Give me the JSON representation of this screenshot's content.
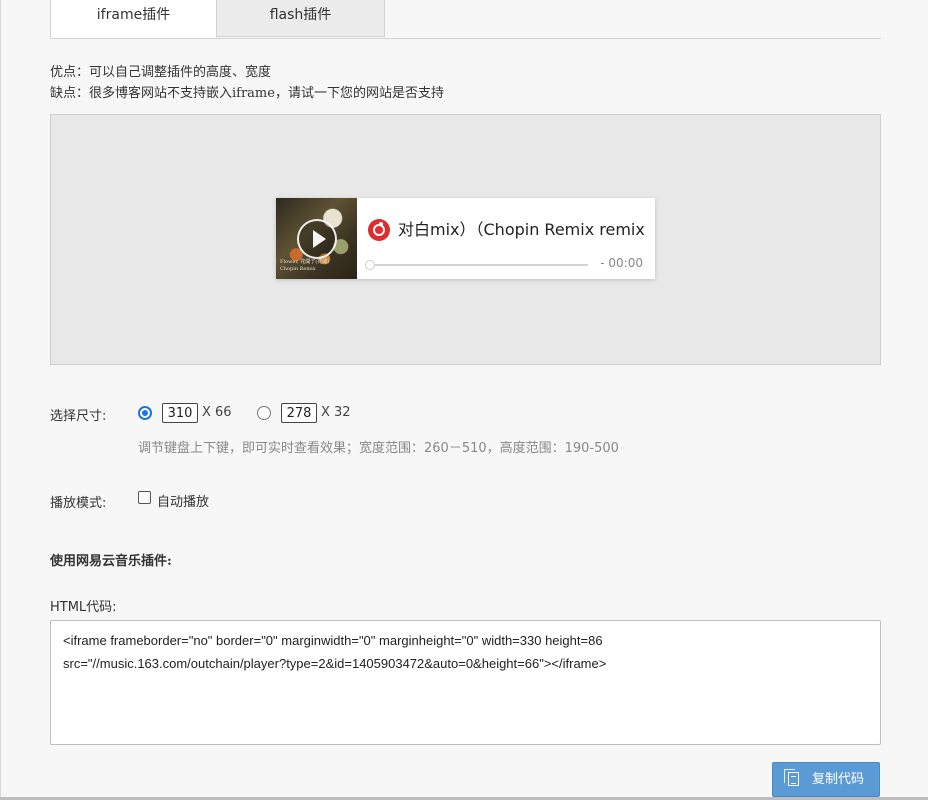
{
  "tabs": [
    {
      "label": "iframe插件",
      "active": true
    },
    {
      "label": "flash插件",
      "active": false
    }
  ],
  "info": {
    "pros": "优点：可以自己调整插件的高度、宽度",
    "cons": "缺点：很多博客网站不支持嵌入iframe，请试一下您的网站是否支持"
  },
  "player": {
    "cover_text_line1": "Flower, 花開了(花開)",
    "cover_text_line2": "Chopin Remix",
    "title": "对白mix）（Chopin Remix remix）",
    "time": "- 00:00",
    "progress": 0
  },
  "size": {
    "label": "选择尺寸:",
    "option1": {
      "width": "310",
      "suffix": "X 66",
      "selected": true
    },
    "option2": {
      "width": "278",
      "suffix": "X 32",
      "selected": false
    },
    "hint": "调节键盘上下键，即可实时查看效果；宽度范围：260－510，高度范围：190-500"
  },
  "mode": {
    "label": "播放模式:",
    "autoplay_label": "自动播放",
    "autoplay_checked": false
  },
  "section_title": "使用网易云音乐插件:",
  "html_code": {
    "label": "HTML代码:",
    "line1": "<iframe frameborder=\"no\" border=\"0\" marginwidth=\"0\" marginheight=\"0\" width=330 height=86",
    "line2": "src=\"//music.163.com/outchain/player?type=2&id=1405903472&auto=0&height=66\"></iframe>"
  },
  "copy_button": {
    "label": "复制代码"
  },
  "colors": {
    "accent": "#1a73e8",
    "button": "#5b9bd5",
    "netease_red": "#e02c2c"
  }
}
